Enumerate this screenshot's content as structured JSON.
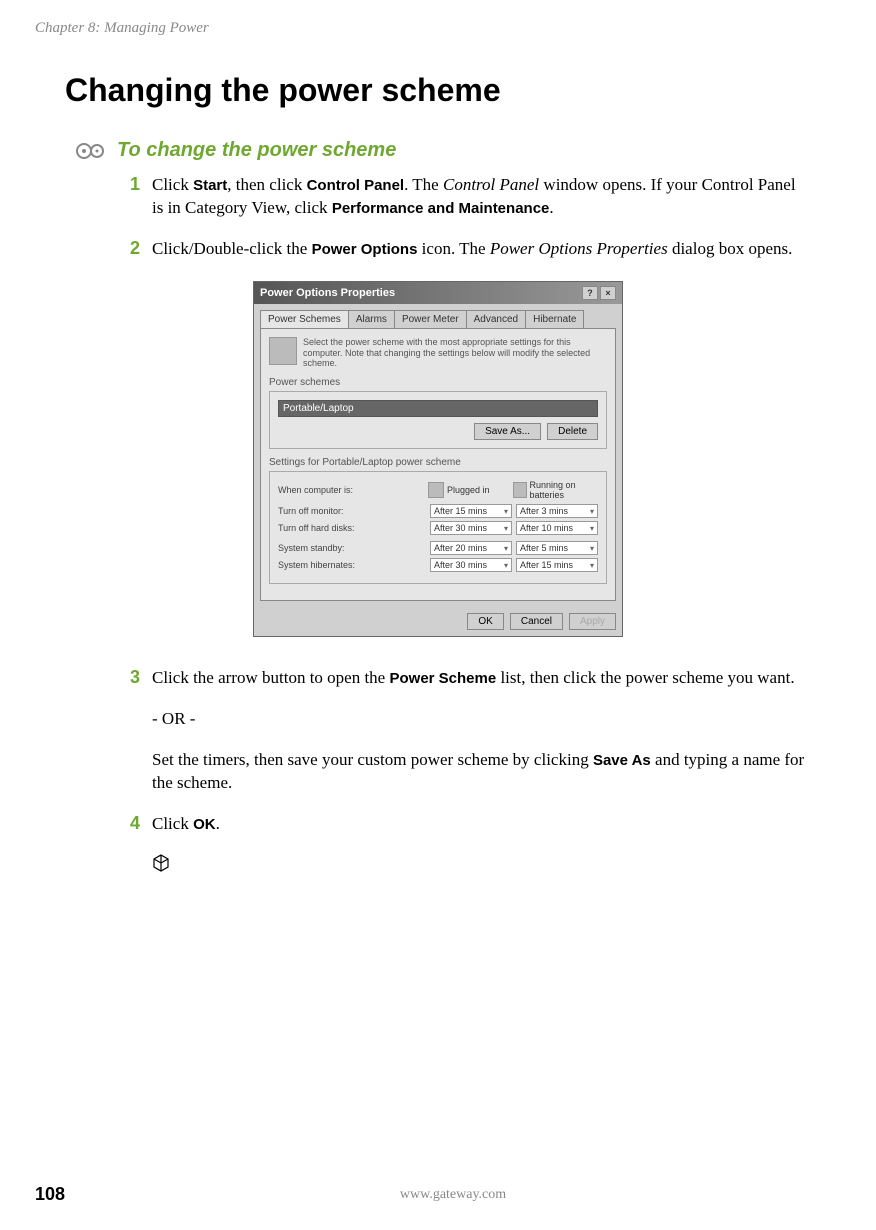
{
  "chapter": "Chapter 8: Managing Power",
  "heading": "Changing the power scheme",
  "task_title": "To change the power scheme",
  "steps": {
    "s1": {
      "num": "1",
      "p1": "Click ",
      "b1": "Start",
      "p2": ", then click ",
      "b2": "Control Panel",
      "p3": ". The ",
      "i1": "Control Panel",
      "p4": " window opens. If your Control Panel is in Category View, click ",
      "b3": "Performance and Maintenance",
      "p5": "."
    },
    "s2": {
      "num": "2",
      "p1": "Click/Double-click the ",
      "b1": "Power Options",
      "p2": " icon. The ",
      "i1": "Power Options Properties",
      "p3": " dialog box opens."
    },
    "s3": {
      "num": "3",
      "p1": "Click the arrow button to open the ",
      "b1": "Power Scheme",
      "p2": " list, then click the power scheme you want."
    },
    "or": "- OR -",
    "s3b": {
      "p1": "Set the timers, then save your custom power scheme by clicking ",
      "b1": "Save As",
      "p2": " and typing a name for the scheme."
    },
    "s4": {
      "num": "4",
      "p1": "Click ",
      "b1": "OK",
      "p2": "."
    }
  },
  "dialog": {
    "title": "Power Options Properties",
    "tabs": [
      "Power Schemes",
      "Alarms",
      "Power Meter",
      "Advanced",
      "Hibernate"
    ],
    "desc": "Select the power scheme with the most appropriate settings for this computer. Note that changing the settings below will modify the selected scheme.",
    "group1_label": "Power schemes",
    "selected_scheme": "Portable/Laptop",
    "save_as": "Save As...",
    "delete": "Delete",
    "group2_label": "Settings for Portable/Laptop power scheme",
    "col_when": "When computer is:",
    "col_plugged": "Plugged in",
    "col_battery": "Running on batteries",
    "rows": [
      {
        "label": "Turn off monitor:",
        "plugged": "After 15 mins",
        "battery": "After 3 mins"
      },
      {
        "label": "Turn off hard disks:",
        "plugged": "After 30 mins",
        "battery": "After 10 mins"
      },
      {
        "label": "System standby:",
        "plugged": "After 20 mins",
        "battery": "After 5 mins"
      },
      {
        "label": "System hibernates:",
        "plugged": "After 30 mins",
        "battery": "After 15 mins"
      }
    ],
    "ok": "OK",
    "cancel": "Cancel",
    "apply": "Apply"
  },
  "footer": {
    "page": "108",
    "url": "www.gateway.com"
  }
}
